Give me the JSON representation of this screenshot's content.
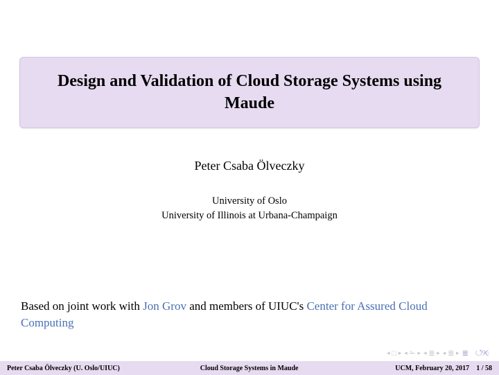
{
  "title": "Design and Validation of Cloud Storage Systems using Maude",
  "author": "Peter Csaba Ölveczky",
  "affiliation_line1": "University of Oslo",
  "affiliation_line2": "University of Illinois at Urbana-Champaign",
  "credit_prefix": "Based on joint work with ",
  "credit_link1": "Jon Grov",
  "credit_mid": " and members of UIUC's ",
  "credit_link2": "Center for Assured Cloud Computing",
  "footer": {
    "left": "Peter Csaba Ölveczky (U. Oslo/UIUC)",
    "center": "Cloud Storage Systems in Maude",
    "date": "UCM, February 20, 2017",
    "page_current": "1",
    "page_sep": " / ",
    "page_total": "58"
  },
  "nav": {
    "undo": "↺੧९"
  }
}
